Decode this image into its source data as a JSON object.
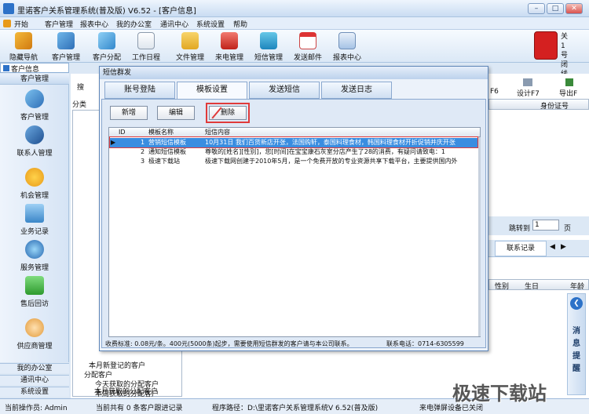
{
  "window": {
    "title": "里诺客户关系管理系统(普及版) V6.52 - [客户信息]"
  },
  "menu": [
    "开始",
    "客户管理",
    "报表中心",
    "我的办公室",
    "通讯中心",
    "系统设置",
    "帮助"
  ],
  "toolbar": [
    "隐藏导航",
    "客户管理",
    "客户分配",
    "工作日程",
    "文件管理",
    "来电管理",
    "短信管理",
    "发送邮件",
    "报表中心"
  ],
  "phone_label": "关 1 号 闭 线",
  "left_tab": "客户信息",
  "sidebar": {
    "header": "客户管理",
    "items": [
      "客户管理",
      "联系人管理",
      "机会管理",
      "业务记录",
      "服务管理",
      "售后回访",
      "供应商管理"
    ],
    "bottom": [
      "我的办公室",
      "通讯中心",
      "系统设置"
    ]
  },
  "main": {
    "search_label": "搜",
    "category_label": "分类",
    "tree": [
      "本月新登记的客户",
      "分配客户",
      "今天获取的分配客户",
      "本周获取的分配客户",
      "本月获取的分配客户"
    ],
    "right_toolbar": [
      "F6",
      "设计F7",
      "导出F"
    ],
    "columns": [
      "身份证号"
    ],
    "jump_label": "跳转到",
    "jump_value": "1",
    "page_label": "页",
    "contact_tab": "联系记录",
    "columns2": [
      "性别",
      "生日",
      "年龄"
    ],
    "msg_panel": "消息提醒"
  },
  "dialog": {
    "title": "短信群发",
    "tabs": [
      "账号登陆",
      "模板设置",
      "发送短信",
      "发送日志"
    ],
    "buttons": [
      "新增",
      "编辑",
      "删除"
    ],
    "grid_headers": [
      "ID",
      "模板名称",
      "短信内容"
    ],
    "rows": [
      {
        "id": "1",
        "name": "营销短信模板",
        "content": "10月31日 我们百货新店开张，法国购轩，泰国料理食材，韩国料理食材开折促销并庆开张"
      },
      {
        "id": "2",
        "name": "通知短信模板",
        "content": "尊敬的[姓名][性别]，您[时间]在宝宝康石灰室分店产生了28的消费，有疑问请致电：1"
      },
      {
        "id": "3",
        "name": "极速下载站",
        "content": "极速下载网创建于2010年5月，是一个免费开放的专业资源共享下载平台，主要提供国内外"
      }
    ],
    "footer": "收费标准: 0.08元/条。400元(5000条)起步，需要使用短信群发的客户请与本公司联系。",
    "phone": "联系电话：0714-6305599"
  },
  "status": {
    "user": "当前操作员: Admin",
    "count": "当前共有 0 条客户跟进记录",
    "path": "程序路径：D:\\里诺客户关系管理系统V 6.52(普及版)",
    "device": "来电弹屏设备已关闭"
  },
  "watermark": "极速下载站"
}
